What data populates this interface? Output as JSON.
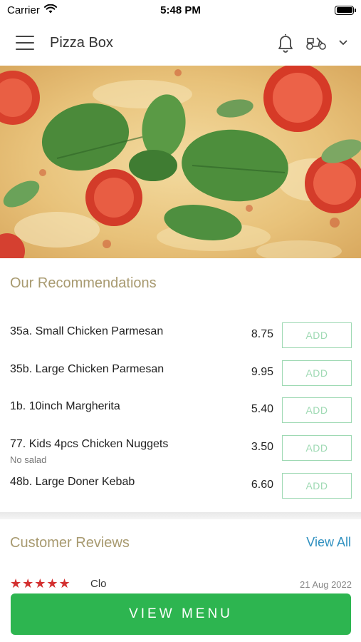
{
  "status_bar": {
    "carrier": "Carrier",
    "time": "5:48 PM"
  },
  "header": {
    "title": "Pizza Box",
    "icons": [
      "menu-icon",
      "bell-icon",
      "scooter-icon",
      "chevron-down-icon"
    ]
  },
  "hero": {
    "image": "pizza-with-basil-tomatoes"
  },
  "recommendations": {
    "title": "Our Recommendations",
    "add_label": "ADD",
    "items": [
      {
        "name": "35a. Small Chicken Parmesan",
        "price": "8.75",
        "note": ""
      },
      {
        "name": "35b. Large Chicken Parmesan",
        "price": "9.95",
        "note": ""
      },
      {
        "name": "1b. 10inch Margherita",
        "price": "5.40",
        "note": ""
      },
      {
        "name": "77. Kids 4pcs Chicken Nuggets",
        "price": "3.50",
        "note": "No salad"
      },
      {
        "name": "48b. Large Doner Kebab",
        "price": "6.60",
        "note": ""
      }
    ]
  },
  "reviews": {
    "title": "Customer Reviews",
    "view_all_label": "View All",
    "items": [
      {
        "stars": 5,
        "stars_text": "★★★★★",
        "name": "Clo",
        "date": "21 Aug 2022"
      }
    ]
  },
  "cta": {
    "label": "VIEW MENU"
  },
  "colors": {
    "accent_green": "#2db550",
    "add_border": "#9ed9b3",
    "section_title": "#a89a70",
    "link_blue": "#2f90c0",
    "star_red": "#d32f2f"
  }
}
